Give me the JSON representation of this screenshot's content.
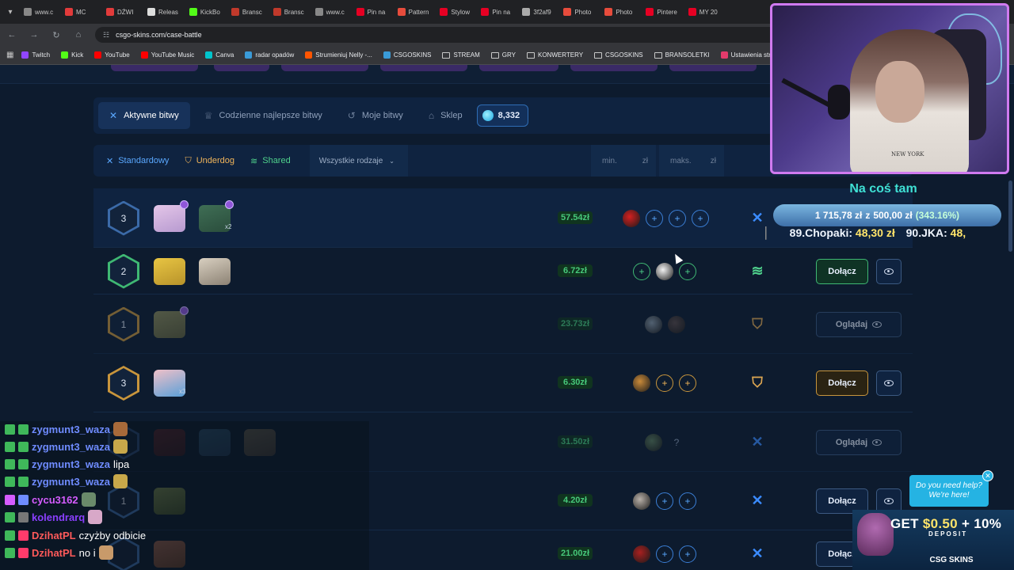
{
  "browser": {
    "tabs": [
      {
        "label": "www.c",
        "color": "#888"
      },
      {
        "label": "MC",
        "color": "#e23b3b"
      },
      {
        "label": "DŹWI",
        "color": "#e23b3b"
      },
      {
        "label": "Releas",
        "color": "#ddd"
      },
      {
        "label": "KickBo",
        "color": "#53fc18"
      },
      {
        "label": "Bransc",
        "color": "#c0392b"
      },
      {
        "label": "Bransc",
        "color": "#c0392b"
      },
      {
        "label": "www.c",
        "color": "#888"
      },
      {
        "label": "Pin na",
        "color": "#e60023"
      },
      {
        "label": "Pattern",
        "color": "#e74c3c"
      },
      {
        "label": "Stylow",
        "color": "#e60023"
      },
      {
        "label": "Pin na",
        "color": "#e60023"
      },
      {
        "label": "3f2af9",
        "color": "#aaa"
      },
      {
        "label": "Photo",
        "color": "#e74c3c"
      },
      {
        "label": "Photo",
        "color": "#e74c3c"
      },
      {
        "label": "Pintere",
        "color": "#e60023"
      },
      {
        "label": "MY 20",
        "color": "#e60023"
      }
    ],
    "url": "csgo-skins.com/case-battle",
    "bookmarks": [
      {
        "label": "Twitch",
        "color": "#9146ff",
        "folder": false
      },
      {
        "label": "Kick",
        "color": "#53fc18",
        "folder": false
      },
      {
        "label": "YouTube",
        "color": "#ff0000",
        "folder": false
      },
      {
        "label": "YouTube Music",
        "color": "#ff0000",
        "folder": false
      },
      {
        "label": "Canva",
        "color": "#00c4cc",
        "folder": false
      },
      {
        "label": "radar opadów",
        "color": "#3a9bd8",
        "folder": false
      },
      {
        "label": "Strumieniuj Nelly -...",
        "color": "#ff5500",
        "folder": false
      },
      {
        "label": "CSGOSKINS",
        "color": "#3a9bd8",
        "folder": false
      },
      {
        "label": "STREAM",
        "color": "",
        "folder": true
      },
      {
        "label": "GRY",
        "color": "",
        "folder": true
      },
      {
        "label": "KONWERTERY",
        "color": "",
        "folder": true
      },
      {
        "label": "CSGOSKINS",
        "color": "",
        "folder": true
      },
      {
        "label": "BRANSOLETKI",
        "color": "",
        "folder": true
      },
      {
        "label": "Ustawienia strumien...",
        "color": "#e23b6b",
        "folder": false
      }
    ]
  },
  "nav": {
    "active_battles": "Aktywne bitwy",
    "daily_best": "Codzienne najlepsze bitwy",
    "my_battles": "Moje bitwy",
    "shop": "Sklep",
    "balance": "8,332"
  },
  "filters": {
    "standard": "Standardowy",
    "underdog": "Underdog",
    "shared": "Shared",
    "all_types": "Wszystkie rodzaje",
    "min_placeholder": "min.",
    "max_placeholder": "maks.",
    "currency": "zł"
  },
  "battles": [
    {
      "rounds": "3",
      "price": "57.54zł",
      "multiplier": "x2",
      "button": "",
      "mode": "standard",
      "tier": "blue"
    },
    {
      "rounds": "2",
      "price": "6.72zł",
      "multiplier": "",
      "button": "Dołącz",
      "mode": "shared",
      "tier": "green"
    },
    {
      "rounds": "1",
      "price": "23.73zł",
      "multiplier": "",
      "button": "Oglądaj",
      "mode": "underdog",
      "tier": "gold"
    },
    {
      "rounds": "3",
      "price": "6.30zł",
      "multiplier": "x3",
      "button": "Dołącz",
      "mode": "underdog",
      "tier": "gold"
    },
    {
      "rounds": "",
      "price": "31.50zł",
      "multiplier": "",
      "button": "Oglądaj",
      "mode": "standard",
      "tier": "blue"
    },
    {
      "rounds": "1",
      "price": "4.20zł",
      "multiplier": "",
      "button": "Dołącz",
      "mode": "standard",
      "tier": "blue"
    },
    {
      "rounds": "",
      "price": "21.00zł",
      "multiplier": "",
      "button": "Dołącz",
      "mode": "standard",
      "tier": "blue"
    }
  ],
  "stream": {
    "overlay_title": "Na coś tam",
    "overlay_amount": "1 715,78 zł",
    "overlay_of": "z",
    "overlay_target": "500,00 zł",
    "overlay_pct": "(343.16%)",
    "ticker_1_num": "89.",
    "ticker_1_name": "Chopaki:",
    "ticker_1_amt": "48,30 zł",
    "ticker_2_num": "90.",
    "ticker_2_name": "JKA:",
    "ticker_2_amt": "48,",
    "chat": [
      {
        "user": "zygmunt3_waza",
        "color": "#6f8cff",
        "msg": ""
      },
      {
        "user": "zygmunt3_waza",
        "color": "#6f8cff",
        "msg": ""
      },
      {
        "user": "zygmunt3_waza",
        "color": "#6f8cff",
        "msg": "lipa"
      },
      {
        "user": "zygmunt3_waza",
        "color": "#6f8cff",
        "msg": ""
      },
      {
        "user": "cycu3162",
        "color": "#d65cff",
        "msg": ""
      },
      {
        "user": "kolendrarq",
        "color": "#8a3fff",
        "msg": ""
      },
      {
        "user": "DzihatPL",
        "color": "#ff5a5a",
        "msg": "czyżby odbicie"
      },
      {
        "user": "DzihatPL",
        "color": "#ff5a5a",
        "msg": "no i"
      }
    ],
    "help_line1": "Do you need help?",
    "help_line2": "We're here!",
    "promo_get": "GET",
    "promo_amount": "$0.50",
    "promo_plus": "+ 10%",
    "promo_deposit": "DEPOSIT",
    "promo_brand": "CSG SKINS"
  }
}
